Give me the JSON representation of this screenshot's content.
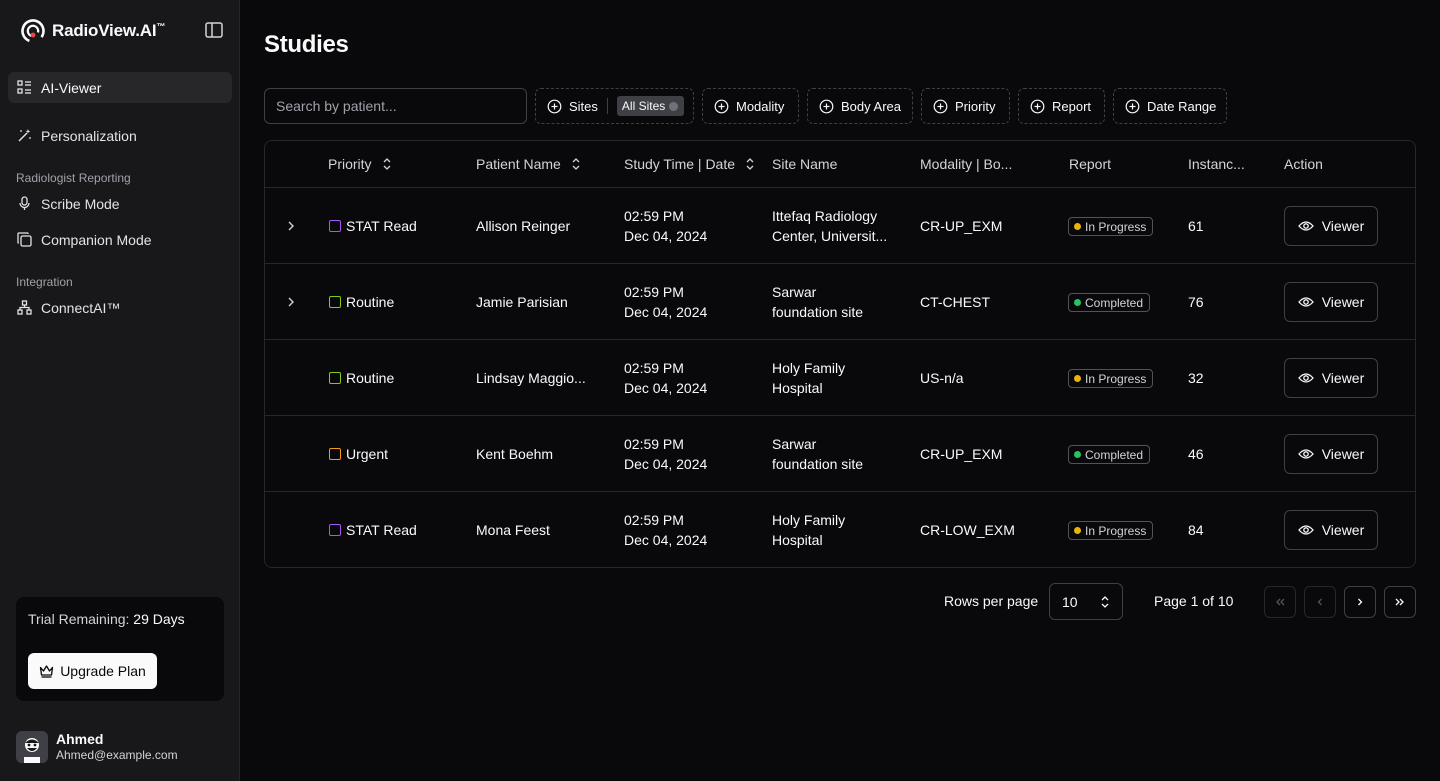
{
  "brand": {
    "name": "RadioView.AI",
    "tm": "™"
  },
  "sidebar": {
    "items": [
      {
        "label": "AI-Viewer"
      },
      {
        "label": "Personalization"
      }
    ],
    "sections": [
      {
        "label": "Radiologist Reporting",
        "items": [
          {
            "label": "Scribe Mode"
          },
          {
            "label": "Companion Mode"
          }
        ]
      },
      {
        "label": "Integration",
        "items": [
          {
            "label": "ConnectAI™"
          }
        ]
      }
    ],
    "trial": {
      "label": "Trial Remaining:",
      "days": "29 Days",
      "upgrade_label": "Upgrade Plan"
    },
    "user": {
      "name": "Ahmed",
      "email": "Ahmed@example.com"
    }
  },
  "main": {
    "title": "Studies",
    "search": {
      "placeholder": "Search by patient...",
      "value": ""
    },
    "filters": {
      "sites": {
        "label": "Sites",
        "chip": "All Sites"
      },
      "modality": "Modality",
      "body_area": "Body Area",
      "priority": "Priority",
      "report": "Report",
      "date_range": "Date Range"
    },
    "table": {
      "headers": {
        "priority": "Priority",
        "patient": "Patient Name",
        "study_time": "Study Time | Date",
        "site": "Site Name",
        "modality": "Modality | Bo...",
        "report": "Report",
        "instances": "Instanc...",
        "action": "Action"
      },
      "viewer_label": "Viewer",
      "rows": [
        {
          "priority": "STAT Read",
          "priority_color": "#a855f7",
          "patient": "Allison Reinger",
          "time": "02:59 PM",
          "date": "Dec 04, 2024",
          "site1": "Ittefaq Radiology",
          "site2": "Center, Universit...",
          "modality": "CR-UP_EXM",
          "report": "In Progress",
          "report_color": "#eab308",
          "instances": "61",
          "expandable": true
        },
        {
          "priority": "Routine",
          "priority_color": "#84cc16",
          "patient": "Jamie Parisian",
          "time": "02:59 PM",
          "date": "Dec 04, 2024",
          "site1": "Sarwar",
          "site2": "foundation site",
          "modality": "CT-CHEST",
          "report": "Completed",
          "report_color": "#22c55e",
          "instances": "76",
          "expandable": true
        },
        {
          "priority": "Routine",
          "priority_color": "#84cc16",
          "patient": "Lindsay Maggio...",
          "time": "02:59 PM",
          "date": "Dec 04, 2024",
          "site1": "Holy Family",
          "site2": "Hospital",
          "modality": "US-n/a",
          "report": "In Progress",
          "report_color": "#eab308",
          "instances": "32",
          "expandable": false
        },
        {
          "priority": "Urgent",
          "priority_color": "#f59e0b",
          "patient": "Kent Boehm",
          "time": "02:59 PM",
          "date": "Dec 04, 2024",
          "site1": "Sarwar",
          "site2": "foundation site",
          "modality": "CR-UP_EXM",
          "report": "Completed",
          "report_color": "#22c55e",
          "instances": "46",
          "expandable": false
        },
        {
          "priority": "STAT Read",
          "priority_color": "#a855f7",
          "patient": "Mona Feest",
          "time": "02:59 PM",
          "date": "Dec 04, 2024",
          "site1": "Holy Family",
          "site2": "Hospital",
          "modality": "CR-LOW_EXM",
          "report": "In Progress",
          "report_color": "#eab308",
          "instances": "84",
          "expandable": false
        }
      ]
    },
    "pagination": {
      "rows_label": "Rows per page",
      "rows_value": "10",
      "page_label": "Page 1 of 10"
    }
  },
  "icons": {
    "nav": [
      "grid-list-icon",
      "magic-wand-icon",
      "microphone-icon",
      "copy-icon",
      "network-icon"
    ],
    "filter": "plus-circle-icon",
    "sort": "chevron-up-down-icon",
    "viewer": "eye-icon"
  }
}
